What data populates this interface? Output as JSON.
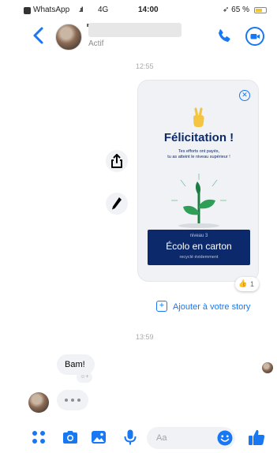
{
  "status_bar": {
    "app": "WhatsApp",
    "network": "4G",
    "time": "14:00",
    "battery": "65 %",
    "battery_level": 0.65
  },
  "header": {
    "subtitle": "Actif"
  },
  "timestamps": [
    "12:55",
    "13:59"
  ],
  "card": {
    "title": "Félicitation !",
    "line1": "Tes efforts ont payés,",
    "line2": "tu as atteint le niveau supérieur !",
    "banner_level": "niveau 3",
    "banner_title": "Écolo en carton",
    "banner_sub": "recyclé évidemment"
  },
  "reaction": {
    "emoji": "👍",
    "count": "1"
  },
  "story_link": "Ajouter à votre story",
  "messages": {
    "bam": "Bam!",
    "add_reaction": "☺+"
  },
  "composer": {
    "placeholder": "Aa"
  },
  "colors": {
    "accent": "#1877f2",
    "card_navy": "#0c2a6b",
    "bubble_bg": "#f0f2f5"
  }
}
